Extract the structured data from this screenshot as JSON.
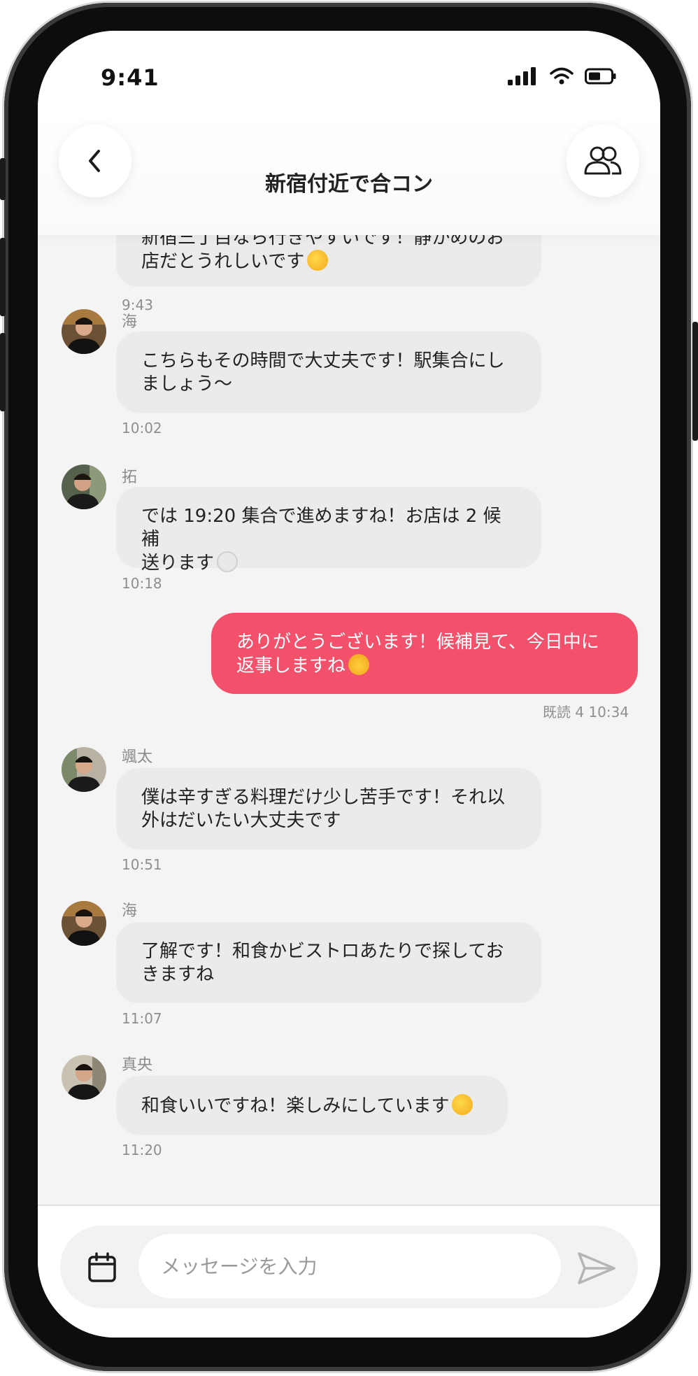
{
  "status_bar": {
    "time": "9:41"
  },
  "header": {
    "title": "新宿付近で合コン"
  },
  "messages": [
    {
      "line1": "新宿三丁目なら行きやすいです！静かめのお",
      "line2": "店だとうれしいです",
      "emoji": "relieved-face-emoji",
      "time": "9:43"
    },
    {
      "sender": "海",
      "line1": "こちらもその時間で大丈夫です！駅集合にし",
      "line2": "ましょう〜",
      "time": "10:02"
    },
    {
      "sender": "拓",
      "line1": "では 19:20 集合で進めますね！お店は 2 候補",
      "line2": "送ります",
      "emoji": "plate-emoji",
      "time": "10:18"
    },
    {
      "mine": true,
      "line1": "ありがとうございます！候補見て、今日中に",
      "line2": "返事しますね",
      "emoji": "raising-hands-emoji",
      "read_status": "既読 4 10:34"
    },
    {
      "sender": "颯太",
      "line1": "僕は辛すぎる料理だけ少し苦手です！それ以",
      "line2": "外はだいたい大丈夫です",
      "time": "10:51"
    },
    {
      "sender": "海",
      "line1": "了解です！和食かビストロあたりで探してお",
      "line2": "きますね",
      "time": "11:07"
    },
    {
      "sender": "真央",
      "line1": "和食いいですね！楽しみにしています",
      "emoji": "smiling-face-emoji",
      "time": "11:20"
    }
  ],
  "composer": {
    "placeholder": "メッセージを入力"
  },
  "colors": {
    "accent": "#f2506b",
    "bubble": "#ebebeb",
    "background": "#f4f4f4"
  }
}
